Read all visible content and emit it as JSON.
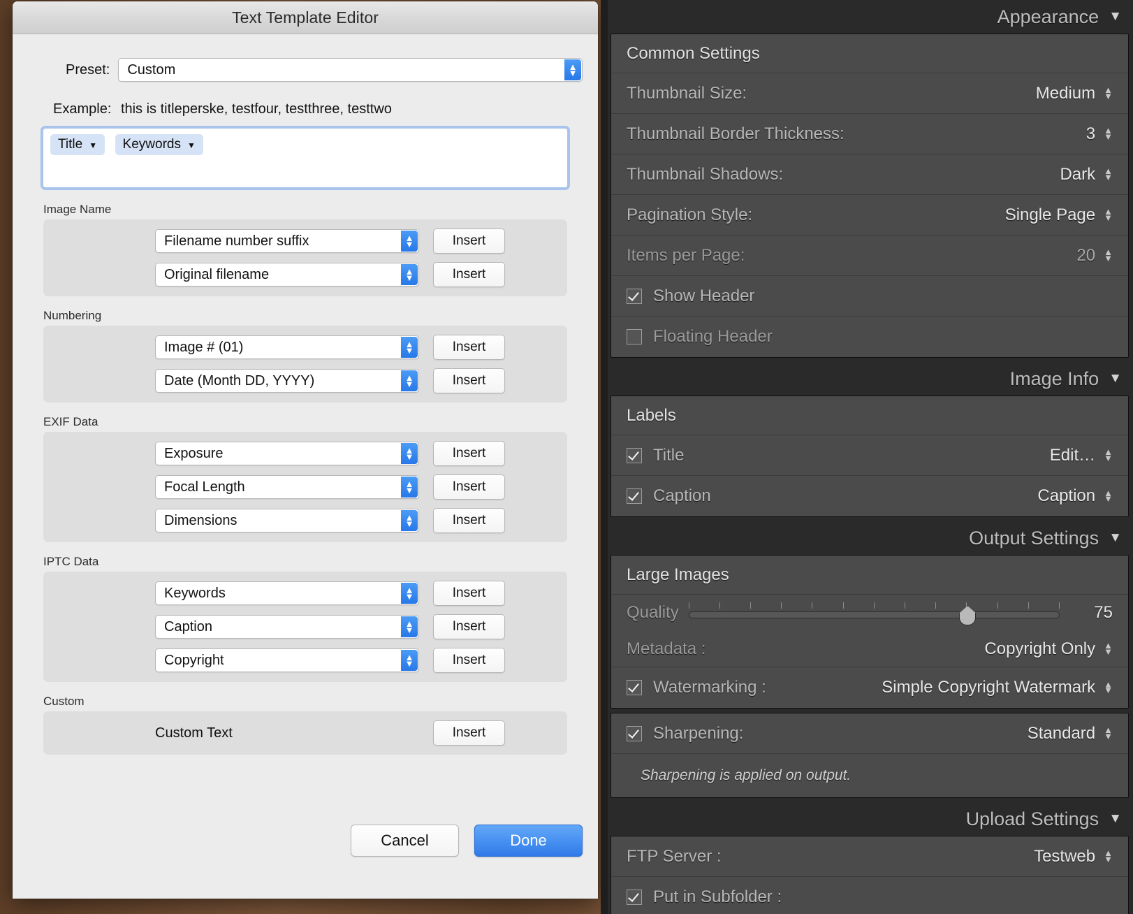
{
  "dialog": {
    "title": "Text Template Editor",
    "preset": {
      "label": "Preset:",
      "value": "Custom"
    },
    "example": {
      "label": "Example:",
      "value": "this is titleperske, testfour, testthree, testtwo"
    },
    "tokens": [
      {
        "label": "Title"
      },
      {
        "label": "Keywords"
      }
    ],
    "insert_label": "Insert",
    "groups": [
      {
        "title": "Image Name",
        "rows": [
          {
            "value": "Filename number suffix",
            "button": "Insert"
          },
          {
            "value": "Original filename",
            "button": "Insert"
          }
        ]
      },
      {
        "title": "Numbering",
        "rows": [
          {
            "value": "Image # (01)",
            "button": "Insert"
          },
          {
            "value": "Date (Month DD, YYYY)",
            "button": "Insert"
          }
        ]
      },
      {
        "title": "EXIF Data",
        "rows": [
          {
            "value": "Exposure",
            "button": "Insert"
          },
          {
            "value": "Focal Length",
            "button": "Insert"
          },
          {
            "value": "Dimensions",
            "button": "Insert"
          }
        ]
      },
      {
        "title": "IPTC Data",
        "rows": [
          {
            "value": "Keywords",
            "button": "Insert"
          },
          {
            "value": "Caption",
            "button": "Insert"
          },
          {
            "value": "Copyright",
            "button": "Insert"
          }
        ]
      }
    ],
    "custom": {
      "title": "Custom",
      "label": "Custom Text",
      "button": "Insert"
    },
    "footer": {
      "cancel": "Cancel",
      "done": "Done"
    }
  },
  "panel": {
    "appearance": {
      "header": "Appearance",
      "section_title": "Common Settings",
      "rows": [
        {
          "label": "Thumbnail Size:",
          "value": "Medium"
        },
        {
          "label": "Thumbnail Border Thickness:",
          "value": "3"
        },
        {
          "label": "Thumbnail Shadows:",
          "value": "Dark"
        },
        {
          "label": "Pagination Style:",
          "value": "Single Page"
        },
        {
          "label": "Items per Page:",
          "value": "20"
        }
      ],
      "checks": [
        {
          "label": "Show Header",
          "checked": true
        },
        {
          "label": "Floating Header",
          "checked": false
        }
      ]
    },
    "image_info": {
      "header": "Image Info",
      "section_title": "Labels",
      "rows": [
        {
          "label": "Title",
          "value": "Edit…",
          "checked": true
        },
        {
          "label": "Caption",
          "value": "Caption",
          "checked": true
        }
      ]
    },
    "output_settings": {
      "header": "Output Settings",
      "section_title": "Large Images",
      "quality": {
        "label": "Quality",
        "value": "75",
        "percent": 75,
        "min": 0,
        "max": 100
      },
      "metadata": {
        "label": "Metadata :",
        "value": "Copyright Only"
      },
      "watermarking": {
        "label": "Watermarking :",
        "value": "Simple Copyright Watermark",
        "checked": true
      },
      "sharpening": {
        "label": "Sharpening:",
        "value": "Standard",
        "checked": true
      },
      "note": "Sharpening is applied on output."
    },
    "upload_settings": {
      "header": "Upload Settings",
      "rows": [
        {
          "label": "FTP Server :",
          "value": "Testweb"
        }
      ],
      "subfolder": {
        "label": "Put in Subfolder :",
        "checked": true
      }
    }
  },
  "colors": {
    "accent_blue": "#2f7ae9",
    "token_bg": "#d6e3f7",
    "panel_bg": "#2a2a2a",
    "panel_box": "#4b4b4b"
  }
}
